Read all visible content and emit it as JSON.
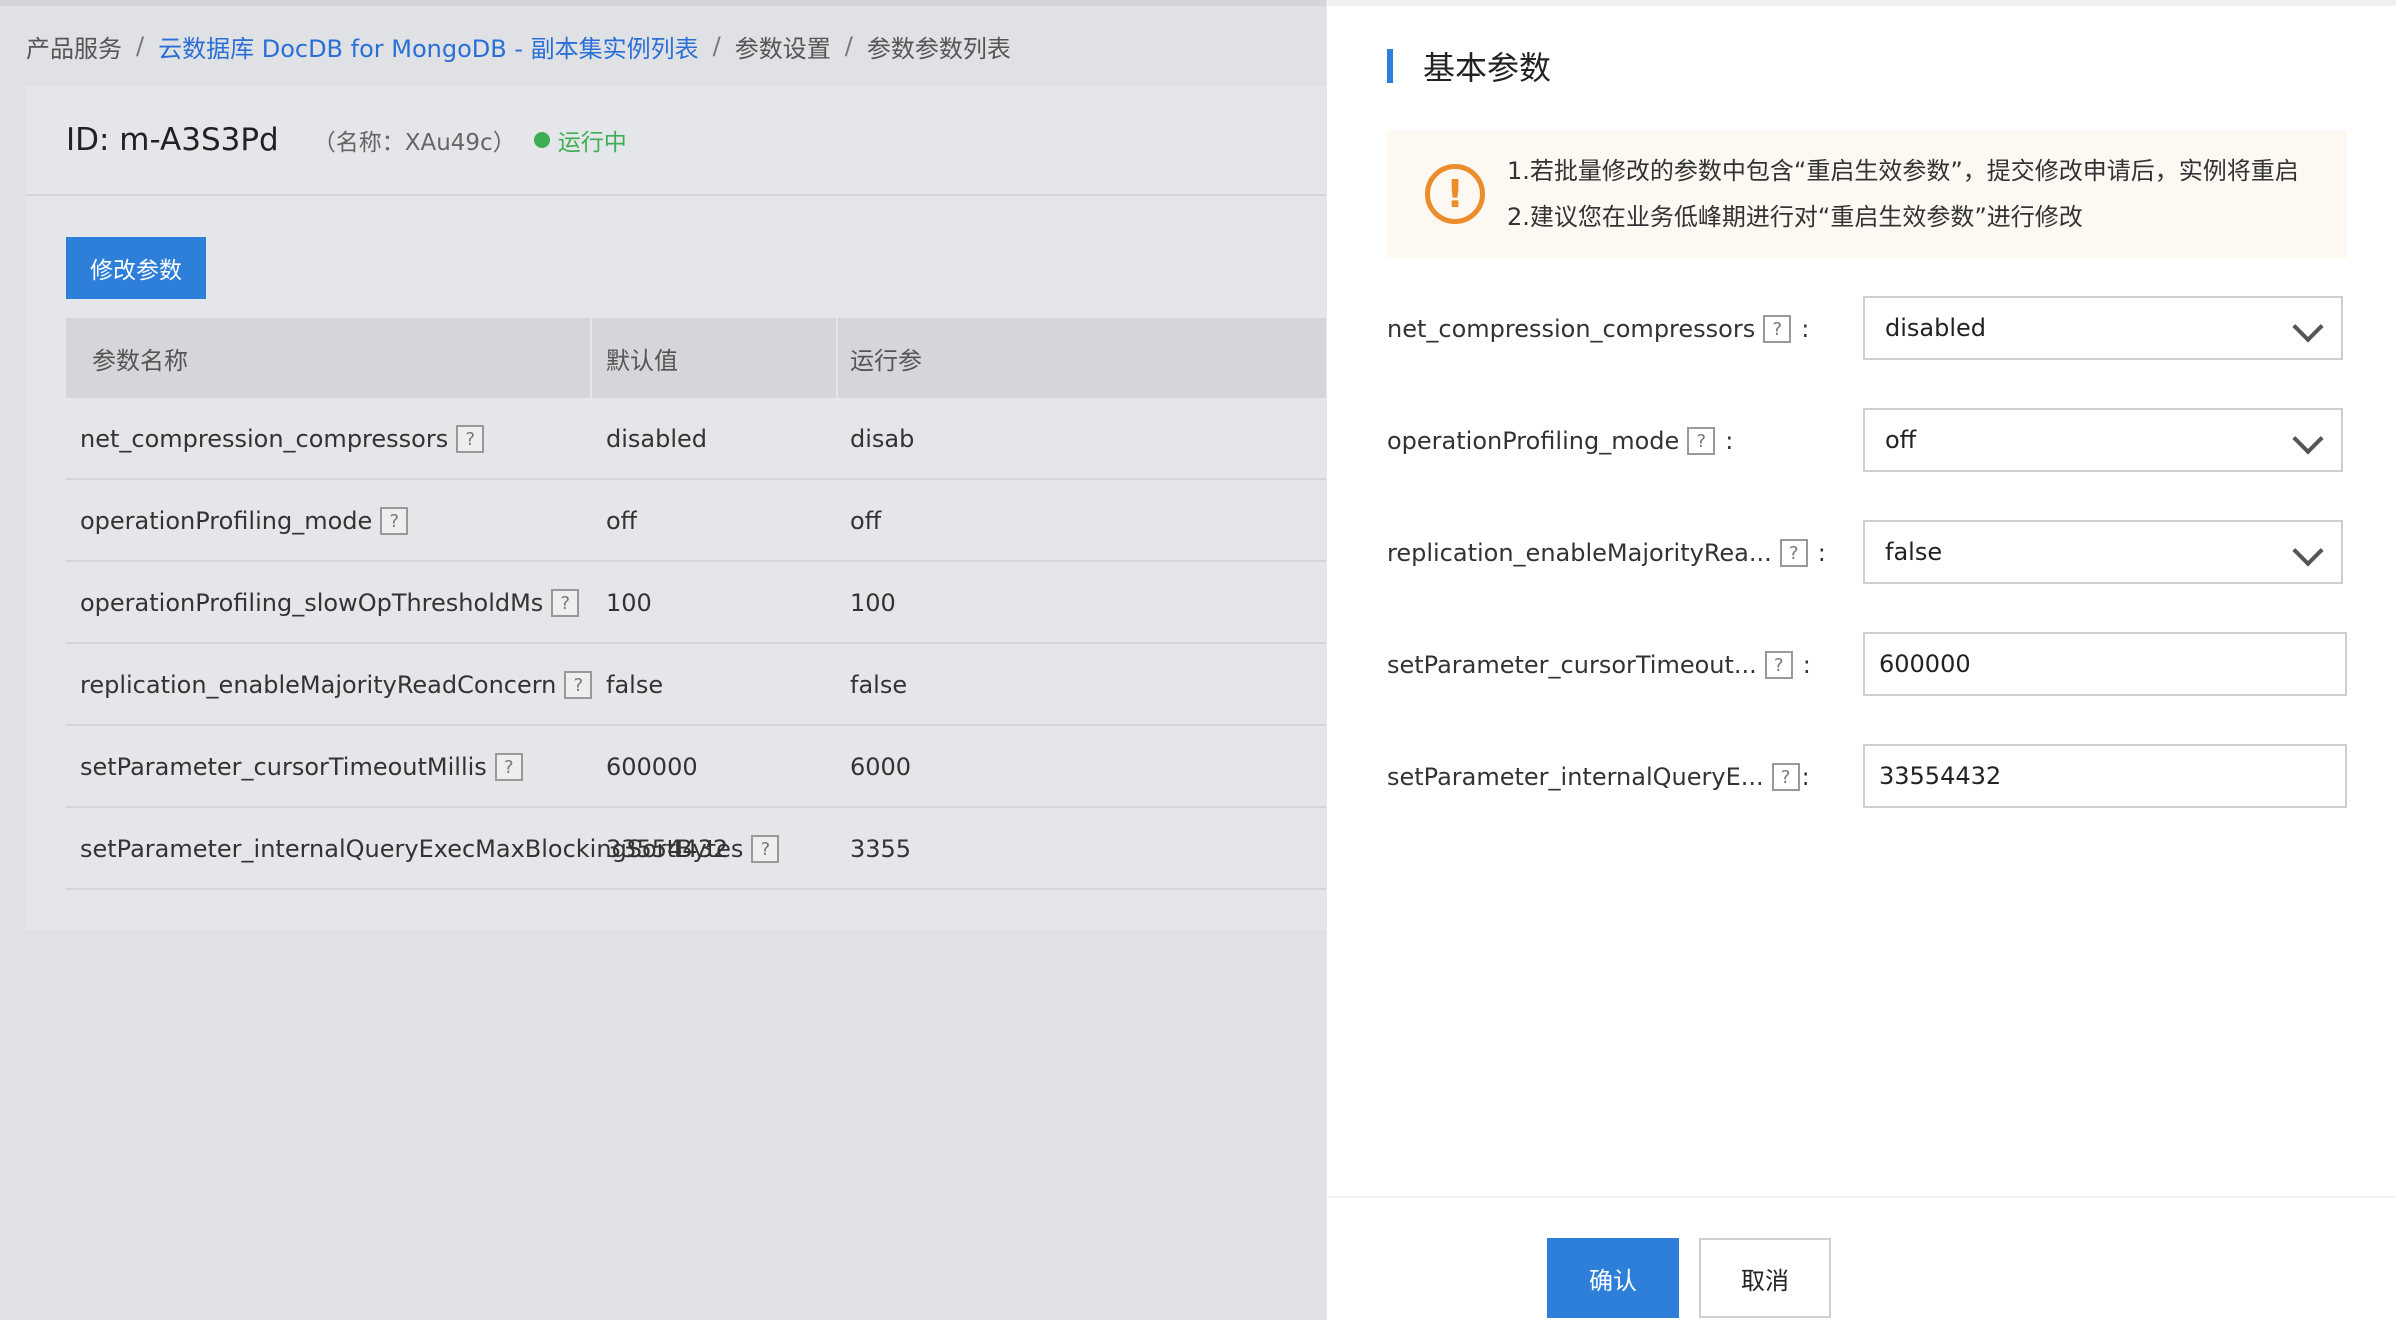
{
  "breadcrumb": {
    "items": [
      "产品服务",
      "云数据库 DocDB for MongoDB - 副本集实例列表",
      "参数设置",
      "参数参数列表"
    ],
    "separator": "/"
  },
  "instance": {
    "id_text": "ID: m-A3S3Pd",
    "alias_text": "（名称：XAu49c）",
    "status": "运行中",
    "status_color": "#3dae55"
  },
  "toolbar": {
    "modify_label": "修改参数"
  },
  "table": {
    "headers": [
      "参数名称",
      "默认值",
      "运行参"
    ],
    "rows": [
      {
        "name": "net_compression_compressors",
        "default": "disabled",
        "running": "disab"
      },
      {
        "name": "operationProfiling_mode",
        "default": "off",
        "running": "off"
      },
      {
        "name": "operationProfiling_slowOpThresholdMs",
        "default": "100",
        "running": "100"
      },
      {
        "name": "replication_enableMajorityReadConcern",
        "default": "false",
        "running": "false"
      },
      {
        "name": "setParameter_cursorTimeoutMillis",
        "default": "600000",
        "running": "6000"
      },
      {
        "name": "setParameter_internalQueryExecMaxBlockingSortBytes",
        "default": "33554432",
        "running": "3355"
      }
    ]
  },
  "help_icon": "?",
  "drawer": {
    "title": "基本参数",
    "notice": {
      "icon": "!",
      "lines": [
        "1.若批量修改的参数中包含“重启生效参数”，提交修改申请后，实例将重启",
        "2.建议您在业务低峰期进行对“重启生效参数”进行修改"
      ]
    },
    "fields": [
      {
        "label": "net_compression_compressors",
        "colon": ":",
        "value": "disabled"
      },
      {
        "label": "operationProfiling_mode",
        "colon": ":",
        "value": "off"
      },
      {
        "label": "replication_enableMajorityRea...",
        "colon": ":",
        "value": "false"
      },
      {
        "label": "setParameter_cursorTimeout...",
        "colon": ":",
        "value": "600000"
      },
      {
        "label": "setParameter_internalQueryE...",
        "colon": ":",
        "value": "33554432"
      }
    ],
    "confirm_label": "确认",
    "cancel_label": "取消"
  },
  "colors": {
    "accent": "#2d7fd9",
    "warning": "#ec8c2a"
  }
}
